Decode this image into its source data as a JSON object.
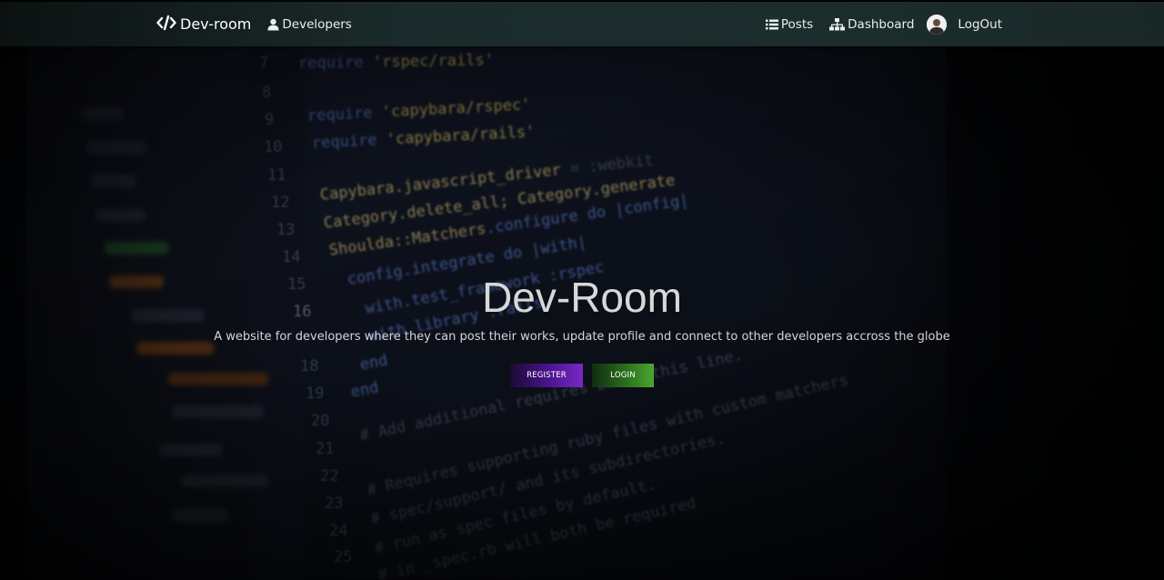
{
  "navbar": {
    "brand_label": "Dev-room",
    "developers_label": "Developers",
    "posts_label": "Posts",
    "dashboard_label": "Dashboard",
    "logout_label": "LogOut",
    "icons": {
      "brand": "code-icon",
      "developers": "user-icon",
      "posts": "list-icon",
      "dashboard": "sitemap-icon",
      "avatar": "avatar"
    }
  },
  "hero": {
    "title": "Dev-Room",
    "subtitle": "A website for developers where they can post their works, update profile and connect to other developers accross the globe",
    "register_label": "REGISTER",
    "login_label": "LOGIN"
  },
  "colors": {
    "navbar": "#1b2b2b",
    "register": "#7a28c6",
    "login": "#4aa832"
  }
}
